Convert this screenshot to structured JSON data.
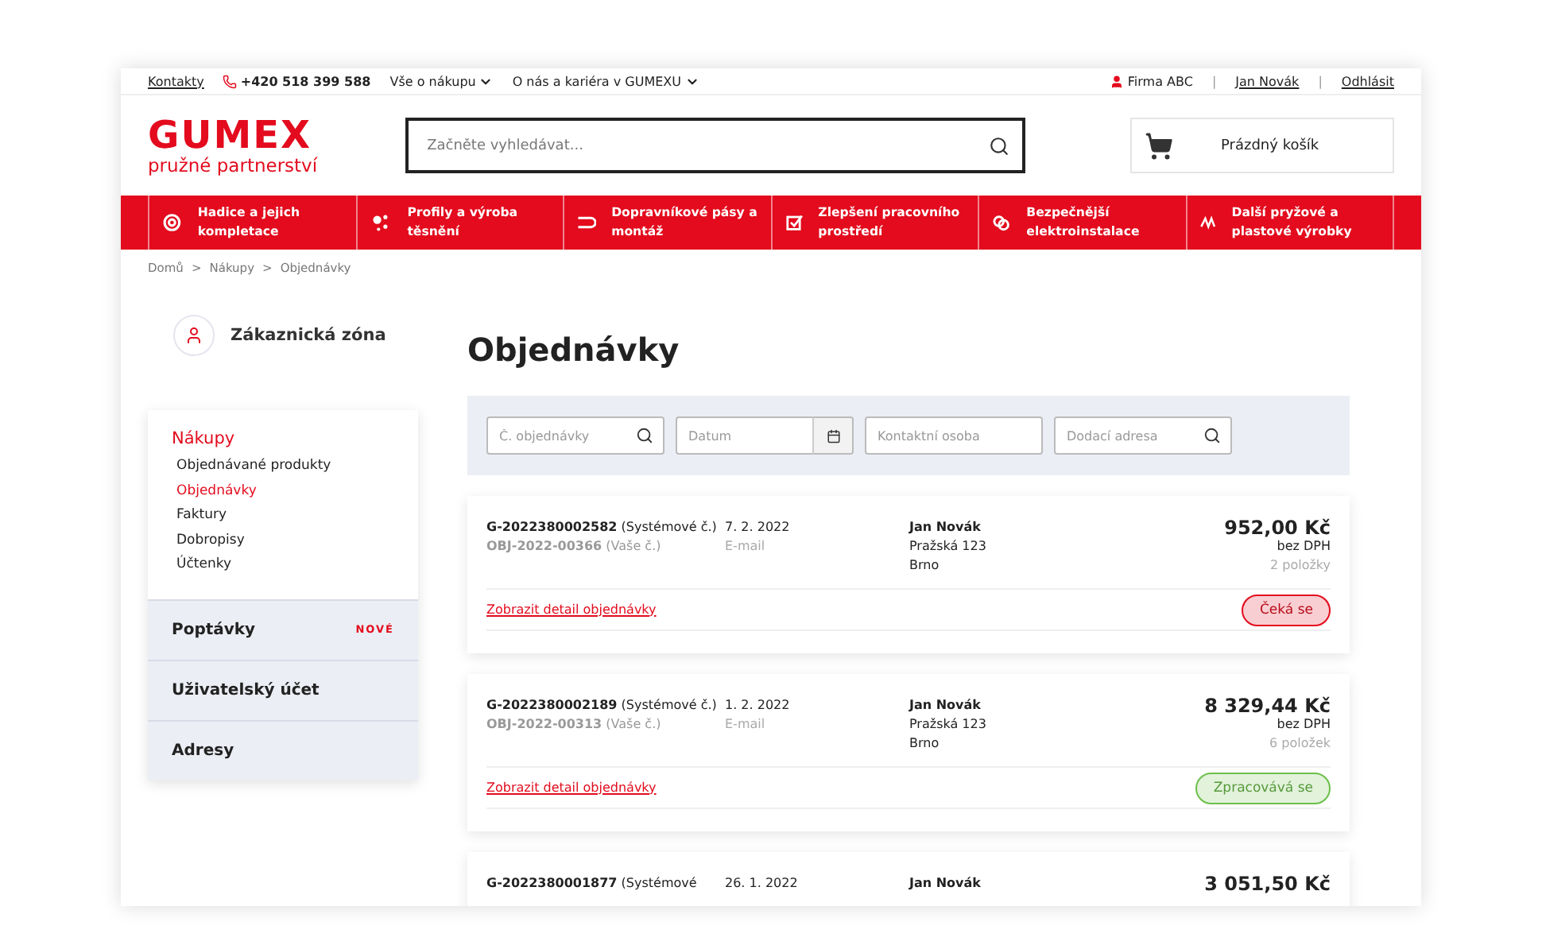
{
  "topbar": {
    "contacts": "Kontakty",
    "phone": "+420 518 399 588",
    "menus": [
      "Vše o nákupu",
      "O nás a kariéra v GUMEXU"
    ],
    "company": "Firma ABC",
    "separator": "|",
    "user": "Jan Novák",
    "separator_2": "|",
    "logout": "Odhlásit"
  },
  "header": {
    "logo": "GUMEX",
    "tagline": "pružné partnerství",
    "search": {
      "placeholder": "Začněte vyhledávat..."
    },
    "cart": "Prázdný košík"
  },
  "nav": [
    {
      "label": "Hadice a jejich kompletace",
      "kind": "hose"
    },
    {
      "label": "Profily a výroba těsnění",
      "kind": "dots"
    },
    {
      "label": "Dopravníkové pásy a montáž",
      "kind": "belt"
    },
    {
      "label": "Zlepšení pracovního prostředí",
      "kind": "check"
    },
    {
      "label": "Bezpečnější elektroinstalace",
      "kind": "plug"
    },
    {
      "label": "Další pryžové a plastové výrobky",
      "kind": "wave"
    }
  ],
  "breadcrumb": [
    "Domů",
    ">",
    "Nákupy",
    ">",
    "Objednávky"
  ],
  "sidebar": {
    "zone": "Zákaznická zóna",
    "section": "Nákupy",
    "items": [
      {
        "label": "Objednávané produkty",
        "selected": false
      },
      {
        "label": "Objednávky",
        "selected": true
      },
      {
        "label": "Faktury",
        "selected": false
      },
      {
        "label": "Dobropisy",
        "selected": false
      },
      {
        "label": "Účtenky",
        "selected": false
      }
    ],
    "groups": [
      {
        "label": "Poptávky",
        "badge": "NOVÉ"
      },
      {
        "label": "Uživatelský účet"
      },
      {
        "label": "Adresy"
      }
    ]
  },
  "page_title": "Objednávky",
  "filters": [
    {
      "placeholder": "Č. objednávky",
      "kind": "search"
    },
    {
      "placeholder": "Datum",
      "kind": "date"
    },
    {
      "placeholder": "Kontaktní osoba",
      "kind": "text"
    },
    {
      "placeholder": "Dodací adresa",
      "kind": "search"
    }
  ],
  "orders": [
    {
      "number": "G-2022380002582",
      "number_note": "(Systémové č.)",
      "our_number": "OBJ-2022-00366",
      "our_note": "(Vaše č.)",
      "date": "7. 2. 2022",
      "channel": "E-mail",
      "name": "Jan Novák",
      "street": "Pražská 123",
      "city": "Brno",
      "price": "952,00 Kč",
      "tax": "bez DPH",
      "count": "2 položky",
      "link": "Zobrazit detail objednávky",
      "status": "Čeká se",
      "color": "#e30b1d"
    },
    {
      "number": "G-2022380002189",
      "number_note": "(Systémové č.)",
      "our_number": "OBJ-2022-00313",
      "our_note": "(Vaše č.)",
      "date": "1. 2. 2022",
      "channel": "E-mail",
      "name": "Jan Novák",
      "street": "Pražská 123",
      "city": "Brno",
      "price": "8 329,44 Kč",
      "tax": "bez DPH",
      "count": "6 položek",
      "link": "Zobrazit detail objednávky",
      "status": "Zpracovává se",
      "color": "#6cbf4a"
    },
    {
      "number": "G-2022380001877",
      "number_note": "(Systémové",
      "date": "26. 1. 2022",
      "name": "Jan Novák",
      "price": "3 051,50 Kč"
    }
  ]
}
